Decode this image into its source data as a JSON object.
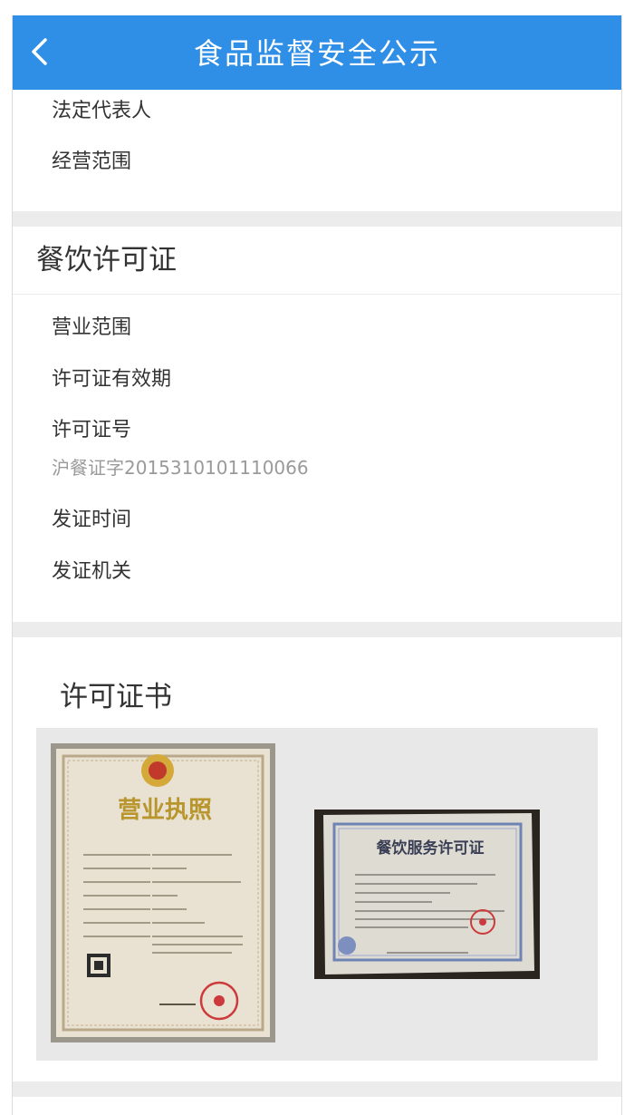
{
  "header": {
    "title": "食品监督安全公示",
    "back_icon": "chevron-left-icon"
  },
  "business_info": {
    "rows": [
      {
        "label": "法定代表人"
      },
      {
        "label": "经营范围"
      }
    ]
  },
  "catering_license": {
    "title": "餐饮许可证",
    "rows": [
      {
        "label": "营业范围"
      },
      {
        "label": "许可证有效期"
      },
      {
        "label": "许可证号",
        "value": "沪餐证字2015310101110066"
      },
      {
        "label": "发证时间"
      },
      {
        "label": "发证机关"
      }
    ]
  },
  "certificates": {
    "title": "许可证书",
    "images": [
      {
        "name": "business-license-photo",
        "caption": "营业执照"
      },
      {
        "name": "catering-permit-photo",
        "caption": "餐饮服务许可证"
      }
    ]
  },
  "colors": {
    "navbar": "#2f8fe6",
    "page_background": "#ececec",
    "card": "#ffffff",
    "label_text": "#333333",
    "value_text": "#9a9a9a"
  }
}
